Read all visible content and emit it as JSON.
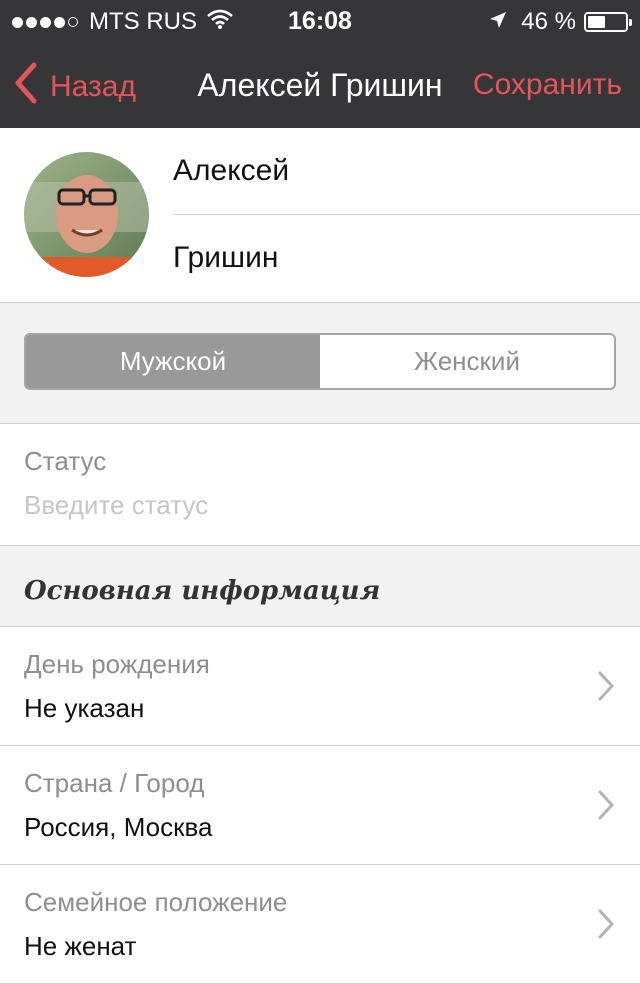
{
  "status_bar": {
    "carrier": "MTS RUS",
    "time": "16:08",
    "battery_percent": "46 %",
    "battery_level": 0.46
  },
  "nav": {
    "back_label": "Назад",
    "title": "Алексей Гришин",
    "save_label": "Сохранить",
    "accent_color": "#e4555a"
  },
  "profile": {
    "first_name": "Алексей",
    "last_name": "Гришин"
  },
  "gender": {
    "options": [
      "Мужской",
      "Женский"
    ],
    "selected": "Мужской"
  },
  "status": {
    "label": "Статус",
    "placeholder": "Введите статус"
  },
  "section": {
    "title": "Основная информация"
  },
  "rows": [
    {
      "label": "День рождения",
      "value": "Не указан"
    },
    {
      "label": "Страна / Город",
      "value": "Россия, Москва"
    },
    {
      "label": "Семейное положение",
      "value": "Не женат"
    }
  ]
}
